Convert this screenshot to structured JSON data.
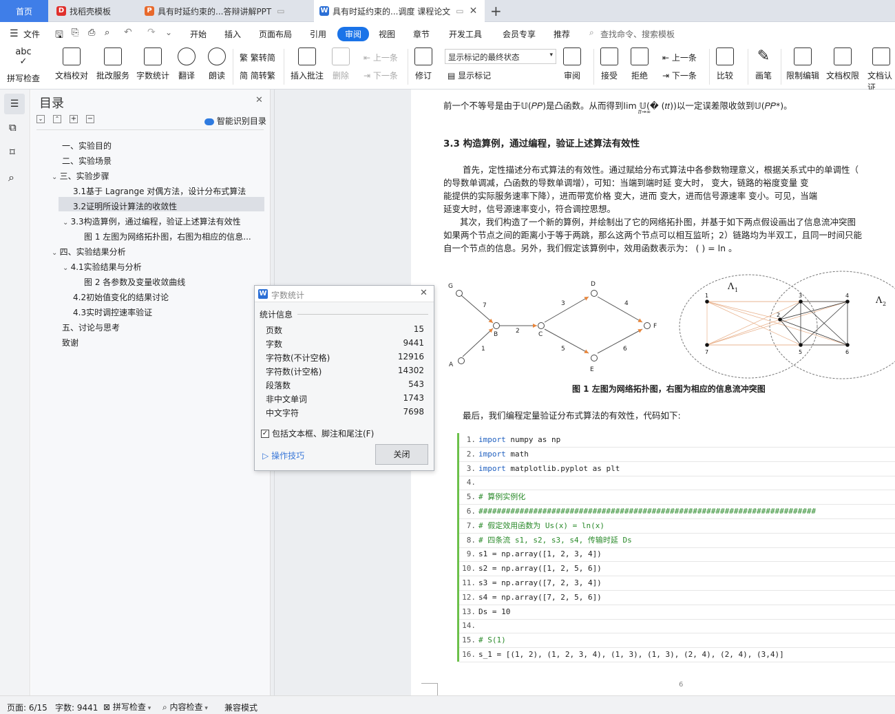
{
  "tabs": [
    {
      "label": "首页",
      "active_home": true
    },
    {
      "label": "找稻壳模板"
    },
    {
      "label": "具有时延约束的...答辩讲解PPT"
    },
    {
      "label": "具有时延约束的...调度 课程论文"
    }
  ],
  "new_tab": "+",
  "menu": {
    "file": "文件",
    "items": [
      "开始",
      "插入",
      "页面布局",
      "引用",
      "审阅",
      "视图",
      "章节",
      "开发工具",
      "会员专享",
      "推荐"
    ],
    "active": "审阅",
    "search": "查找命令、搜索模板"
  },
  "ribbon": {
    "spell": "拼写检查",
    "proof": "文档校对",
    "correct_service": "批改服务",
    "wordcount": "字数统计",
    "translate": "翻译",
    "read": "朗读",
    "to_trad": "繁转简",
    "to_simp": "简转繁",
    "insert_comment": "插入批注",
    "delete": "删除",
    "prev": "上一条",
    "next": "下一条",
    "revise": "修订",
    "markup_state": "显示标记的最终状态",
    "show_markup": "显示标记",
    "review": "审阅",
    "accept": "接受",
    "reject": "拒绝",
    "prev2": "上一条",
    "next2": "下一条",
    "compare": "比较",
    "pen": "画笔",
    "restrict": "限制编辑",
    "rights": "文档权限",
    "verify": "文档认证"
  },
  "toc": {
    "title": "目录",
    "smart": "智能识别目录",
    "items": [
      {
        "label": "一、实验目的"
      },
      {
        "label": "二、实验场景"
      },
      {
        "label": "三、实验步骤"
      },
      {
        "label": "3.1基于 Lagrange 对偶方法，设计分布式算法"
      },
      {
        "label": "3.2证明所设计算法的收敛性"
      },
      {
        "label": "3.3构造算例，通过编程，验证上述算法有效性"
      },
      {
        "label": "图 1  左图为网络拓扑图，右图为相应的信息..."
      },
      {
        "label": "四、实验结果分析"
      },
      {
        "label": "4.1实验结果与分析"
      },
      {
        "label": "图 2 各参数及变量收敛曲线"
      },
      {
        "label": "4.2初始值变化的结果讨论"
      },
      {
        "label": "4.3实时调控速率验证"
      },
      {
        "label": "五、讨论与思考"
      },
      {
        "label": "致谢"
      }
    ]
  },
  "doc": {
    "line1": "前一个不等号是由于𝕌(𝑃𝑃)是凸函数。从而得到lim 𝕌(� (𝑡𝑡))以一定误差限收敛到𝕌(𝑃𝑃*)。",
    "lim_sub": "𝑡𝑡→∞",
    "heading": "3.3 构造算例，通过编程，验证上述算法有效性",
    "p1": [
      "首先，定性描述分布式算法的有效性。通过赋给分布式算法中各参数物理意义，根据关系式中的单调性（",
      "的导数单调减，凸函数的导数单调增），可知：当端到端时延      变大时，        变大，链路的裕度变量      变",
      "能提供的实际服务速率下降），进而带宽价格        变大，进而        变大，进而信号源速率        变小。可见，当端",
      "延变大时，信号源速率变小，符合调控思想。"
    ],
    "p2": [
      "其次，我们构造了一个新的算例，并绘制出了它的网络拓扑图，并基于如下两点假设画出了信息流冲突图",
      "如果两个节点之间的距离小于等于两跳，那么这两个节点可以相互监听；2）链路均为半双工，且同一时间只能",
      "自一个节点的信息。另外，我们假定该算例中，效用函数表示为：      (      ) = ln       。"
    ],
    "fig_caption": "图 1  左图为网络拓扑图，右图为相应的信息流冲突图",
    "p3": "最后，我们编程定量验证分布式算法的有效性，代码如下:",
    "page_number": "6"
  },
  "graph_left": {
    "nodes": [
      "G",
      "B",
      "C",
      "D",
      "E",
      "F",
      "A"
    ],
    "edge_labels": [
      "7",
      "2",
      "3",
      "4",
      "1",
      "5",
      "6"
    ]
  },
  "graph_right": {
    "lambda1": "Λ",
    "lambda1_sub": "1",
    "lambda2": "Λ",
    "lambda2_sub": "2",
    "nodes": [
      "1",
      "2",
      "3",
      "4",
      "5",
      "6",
      "7"
    ]
  },
  "code": [
    {
      "n": "1.",
      "kw": "import",
      "rest": " numpy as np"
    },
    {
      "n": "2.",
      "kw": "import",
      "rest": " math"
    },
    {
      "n": "3.",
      "kw": "import",
      "rest": " matplotlib.pyplot as plt"
    },
    {
      "n": "4.",
      "kw": "",
      "rest": ""
    },
    {
      "n": "5.",
      "cm": "# 算例实例化"
    },
    {
      "n": "6.",
      "cm": "##########################################################################"
    },
    {
      "n": "7.",
      "cm": "# 假定效用函数为 Us(x) = ln(x)"
    },
    {
      "n": "8.",
      "cm": "# 四条流 s1, s2, s3, s4, 传输时延 Ds"
    },
    {
      "n": "9.",
      "kw": "",
      "rest": "s1 = np.array([1, 2, 3, 4])"
    },
    {
      "n": "10.",
      "kw": "",
      "rest": "s2 = np.array([1, 2, 5, 6])"
    },
    {
      "n": "11.",
      "kw": "",
      "rest": "s3 = np.array([7, 2, 3, 4])"
    },
    {
      "n": "12.",
      "kw": "",
      "rest": "s4 = np.array([7, 2, 5, 6])"
    },
    {
      "n": "13.",
      "kw": "",
      "rest": "Ds = 10"
    },
    {
      "n": "14.",
      "kw": "",
      "rest": ""
    },
    {
      "n": "15.",
      "cm": "# S(1)"
    },
    {
      "n": "16.",
      "kw": "",
      "rest": "s_1 = [(1, 2), (1, 2, 3, 4), (1, 3), (1, 3), (2, 4), (2, 4), (3,4)]"
    }
  ],
  "dialog": {
    "title": "字数统计",
    "section": "统计信息",
    "rows": [
      {
        "label": "页数",
        "value": "15"
      },
      {
        "label": "字数",
        "value": "9441"
      },
      {
        "label": "字符数(不计空格)",
        "value": "12916"
      },
      {
        "label": "字符数(计空格)",
        "value": "14302"
      },
      {
        "label": "段落数",
        "value": "543"
      },
      {
        "label": "非中文单词",
        "value": "1743"
      },
      {
        "label": "中文字符",
        "value": "7698"
      }
    ],
    "include_label": "包括文本框、脚注和尾注(F)",
    "include_checked": true,
    "tips": "操作技巧",
    "close": "关闭"
  },
  "status": {
    "page": "页面: 6/15",
    "words": "字数: 9441",
    "spell": "拼写检查",
    "content": "内容检查",
    "compat": "兼容模式"
  },
  "colors": {
    "accent": "#1a73e8",
    "home_tab": "#3f7ee8",
    "code_bar": "#6cc04a"
  }
}
